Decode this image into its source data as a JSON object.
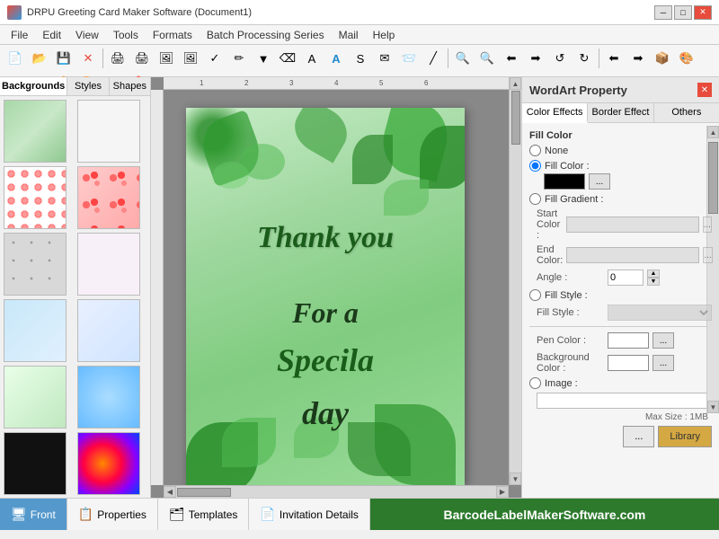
{
  "titlebar": {
    "icon": "app-icon",
    "title": "DRPU Greeting Card Maker Software (Document1)",
    "controls": [
      "minimize",
      "maximize",
      "close"
    ]
  },
  "menubar": {
    "items": [
      "File",
      "Edit",
      "View",
      "Tools",
      "Formats",
      "Batch Processing Series",
      "Mail",
      "Help"
    ]
  },
  "left_panel": {
    "tabs": [
      "Backgrounds",
      "Styles",
      "Shapes"
    ],
    "active_tab": "Backgrounds"
  },
  "canvas": {
    "card_lines": [
      "Thank you",
      "For a",
      "Specila",
      "day"
    ]
  },
  "right_panel": {
    "title": "WordArt Property",
    "tabs": [
      "Color Effects",
      "Border Effect",
      "Others"
    ],
    "active_tab": "Color Effects",
    "fill_color_section": {
      "label": "Fill Color",
      "none_label": "None",
      "fill_color_label": "Fill Color :",
      "fill_gradient_label": "Fill Gradient :",
      "fill_style_label": "Fill Style :",
      "start_color_label": "Start Color :",
      "end_color_label": "End Color:",
      "angle_label": "Angle :",
      "angle_value": "0",
      "fill_style_value": "",
      "pen_color_label": "Pen Color :",
      "background_color_label": "Background Color :",
      "image_label": "Image :",
      "max_size_label": "Max Size : 1MB",
      "library_btn": "Library",
      "dots_btn": "..."
    }
  },
  "statusbar": {
    "tabs": [
      {
        "label": "Front",
        "icon": "front-icon",
        "active": true
      },
      {
        "label": "Properties",
        "icon": "properties-icon",
        "active": false
      },
      {
        "label": "Templates",
        "icon": "templates-icon",
        "active": false
      },
      {
        "label": "Invitation Details",
        "icon": "invitation-icon",
        "active": false
      }
    ],
    "brand": "BarcodeLabelMakerSoftware.com"
  },
  "toolbar": {
    "buttons": [
      "📄",
      "📂",
      "💾",
      "❌",
      "📋",
      "📑",
      "🖨",
      "🖼",
      "📷",
      "✏",
      "🖊",
      "📝",
      "🔤",
      "📊",
      "✉",
      "🎯",
      "S",
      "✉",
      "📨",
      "📐",
      "🔧",
      "🔍",
      "🔎",
      "⬅",
      "➡",
      "⭮",
      "⭯",
      "📦",
      "🎨",
      "❓"
    ]
  }
}
